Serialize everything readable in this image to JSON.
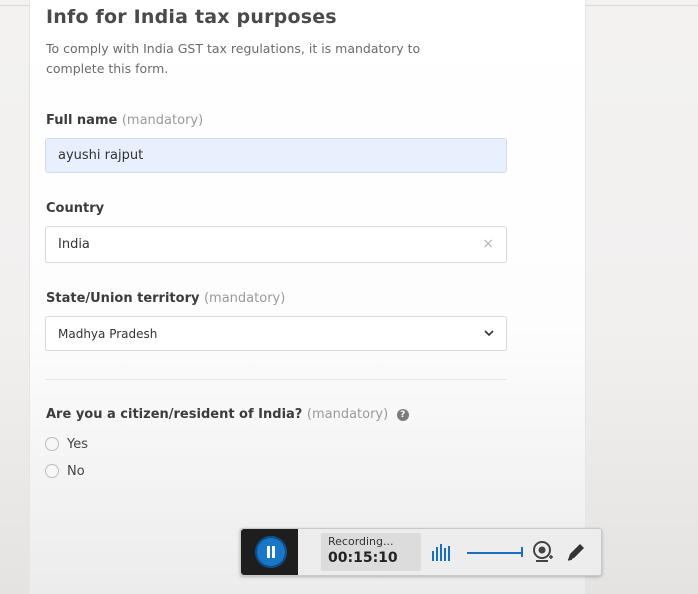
{
  "form": {
    "title": "Info for India tax purposes",
    "subtitle": "To comply with India GST tax regulations, it is mandatory to complete this form.",
    "full_name": {
      "label": "Full name",
      "required_note": "(mandatory)",
      "value": "ayushi rajput"
    },
    "country": {
      "label": "Country",
      "value": "India",
      "clear_glyph": "×"
    },
    "state": {
      "label": "State/Union territory",
      "required_note": "(mandatory)",
      "value": "Madhya Pradesh"
    },
    "citizen": {
      "question": "Are you a citizen/resident of India?",
      "required_note": "(mandatory)",
      "help_glyph": "?",
      "options": [
        "Yes",
        "No"
      ]
    }
  },
  "recorder": {
    "status": "Recording...",
    "elapsed": "00:15:10",
    "icons": [
      "pause-icon",
      "audio-level-icon",
      "webcam-icon",
      "pen-icon"
    ],
    "accent_color": "#1877c9"
  }
}
